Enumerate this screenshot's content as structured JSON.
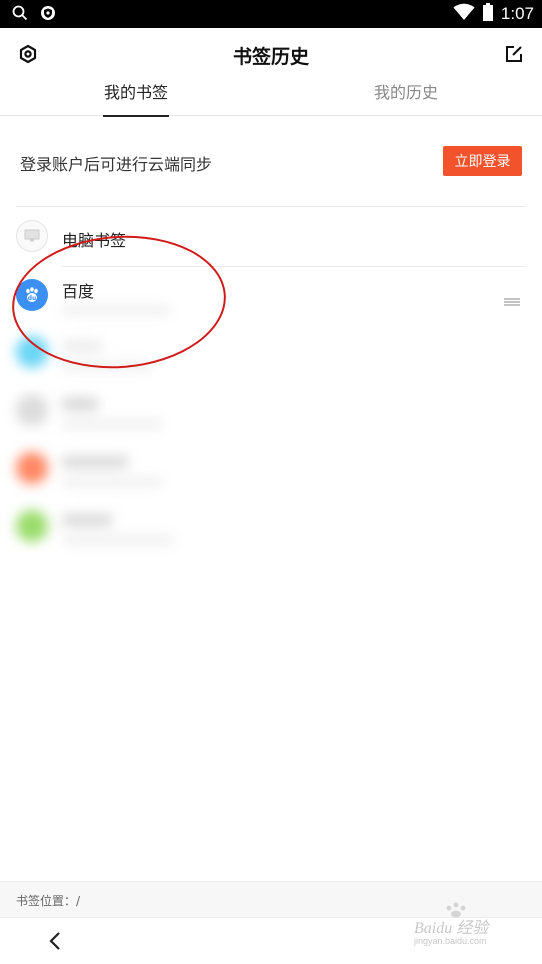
{
  "status_bar": {
    "time": "1:07",
    "icons": [
      "search-icon",
      "shield-icon",
      "wifi-icon",
      "battery-icon"
    ]
  },
  "header": {
    "title": "书签历史",
    "left_icon": "settings-icon",
    "right_icon": "edit-icon"
  },
  "tabs": [
    {
      "label": "我的书签",
      "active": true
    },
    {
      "label": "我的历史",
      "active": false
    }
  ],
  "login": {
    "text": "登录账户后可进行云端同步",
    "button_label": "立即登录",
    "button_color": "#f2532d"
  },
  "bookmarks": [
    {
      "name": "电脑书签",
      "icon": "monitor-icon"
    },
    {
      "name": "百度",
      "icon": "baidu-paw-icon",
      "icon_color": "#3b8ff5"
    }
  ],
  "blurred_items": [
    {
      "color": "#5ad0f5"
    },
    {
      "color": "#d8d8d8"
    },
    {
      "color": "#ff7a52"
    },
    {
      "color": "#8fd85a"
    }
  ],
  "footer": {
    "location_label": "书签位置：/",
    "back_icon": "back-arrow-icon"
  },
  "watermark": {
    "text": "Baidu 经验",
    "url": "jingyan.baidu.com"
  }
}
